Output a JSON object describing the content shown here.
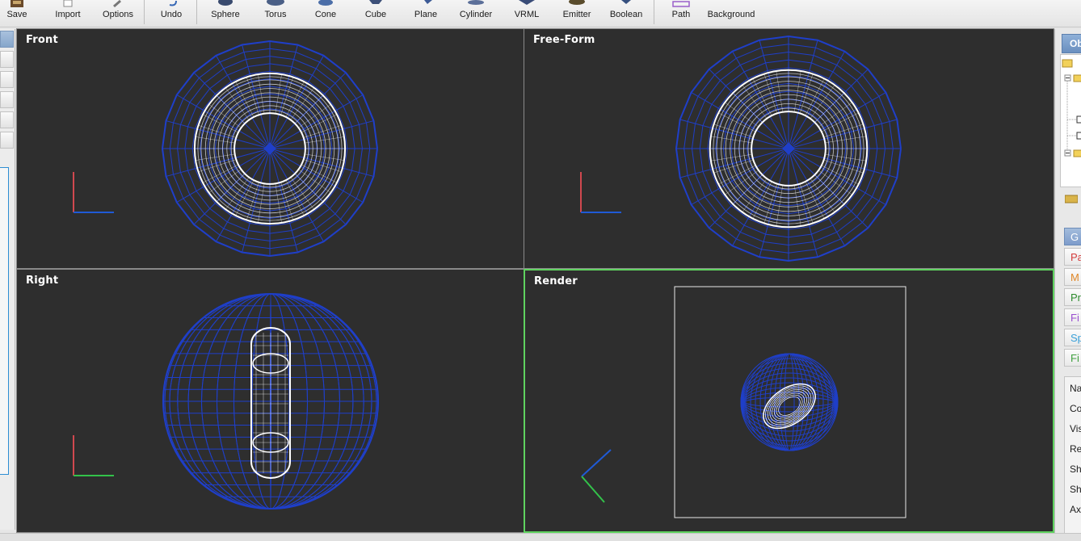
{
  "toolbar": {
    "items": [
      {
        "label": "Save",
        "icon": "save-icon"
      },
      {
        "label": "Import",
        "icon": "import-icon"
      },
      {
        "label": "Options",
        "icon": "options-icon"
      },
      {
        "label": "Undo",
        "icon": "undo-icon"
      },
      {
        "label": "Sphere",
        "icon": "sphere-icon"
      },
      {
        "label": "Torus",
        "icon": "torus-icon"
      },
      {
        "label": "Cone",
        "icon": "cone-icon"
      },
      {
        "label": "Cube",
        "icon": "cube-icon"
      },
      {
        "label": "Plane",
        "icon": "plane-icon"
      },
      {
        "label": "Cylinder",
        "icon": "cylinder-icon"
      },
      {
        "label": "VRML",
        "icon": "vrml-icon"
      },
      {
        "label": "Emitter",
        "icon": "emitter-icon"
      },
      {
        "label": "Boolean",
        "icon": "boolean-icon"
      },
      {
        "label": "Path",
        "icon": "path-icon"
      },
      {
        "label": "Background",
        "icon": "background-icon"
      }
    ]
  },
  "viewports": {
    "front": {
      "title": "Front"
    },
    "freeform": {
      "title": "Free-Form"
    },
    "right": {
      "title": "Right"
    },
    "render": {
      "title": "Render"
    }
  },
  "right_panel": {
    "tab_label": "Ob",
    "categories": [
      {
        "label": "G",
        "color": "#ffffff"
      },
      {
        "label": "Pa",
        "color": "#d43c3c"
      },
      {
        "label": "M",
        "color": "#e0882a"
      },
      {
        "label": "Pr",
        "color": "#2e8b2e"
      },
      {
        "label": "Fi",
        "color": "#9a4fd0"
      },
      {
        "label": "Sp",
        "color": "#3aa0d8"
      },
      {
        "label": "Fi",
        "color": "#3fa03f"
      }
    ],
    "properties": [
      "Na",
      "Co",
      "Vis",
      "Re",
      "Sh",
      "Sh",
      "Axe"
    ]
  },
  "colors": {
    "viewport_bg": "#2e2e2e",
    "wire_blue": "#1f3fc9",
    "wire_white": "#ffffff",
    "active_border": "#5fd35f",
    "axis_red": "#d0484f",
    "axis_blue": "#1f5ad6",
    "axis_green": "#33c24a"
  }
}
